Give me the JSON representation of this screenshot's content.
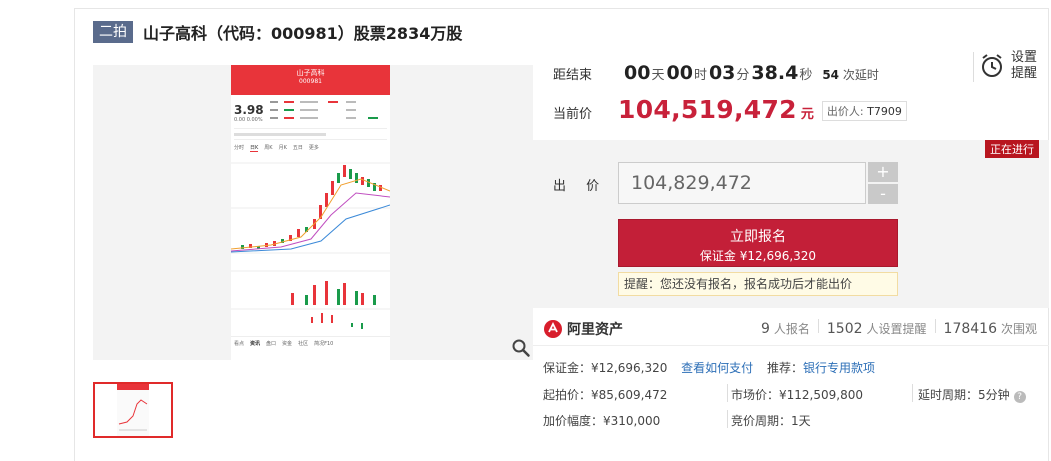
{
  "title": {
    "badge": "二拍",
    "text": "山子高科（代码：000981）股票2834万股"
  },
  "countdown": {
    "label": "距结束",
    "days": "00",
    "days_unit": "天",
    "hours": "00",
    "hours_unit": "时",
    "minutes": "03",
    "minutes_unit": "分",
    "seconds": "38.4",
    "seconds_unit": "秒",
    "delay_count": "54",
    "delay_label": "次延时"
  },
  "remind": {
    "line1": "设置",
    "line2": "提醒"
  },
  "current_price": {
    "label": "当前价",
    "value": "104,519,472",
    "unit": "元",
    "bidder_label": "出价人:",
    "bidder_id": "T7909"
  },
  "status": "正在进行",
  "bid": {
    "label": "出 价",
    "value": "104,829,472",
    "plus": "+",
    "minus": "-",
    "signup_label": "立即报名",
    "deposit_label": "保证金 ¥12,696,320",
    "tip": "提醒：您还没有报名，报名成功后才能出价"
  },
  "platform": {
    "name": "阿里资产"
  },
  "stats": {
    "signup_count": "9",
    "signup_label": "人报名",
    "remind_count": "1502",
    "remind_label": "人设置提醒",
    "watch_count": "178416",
    "watch_label": "次围观"
  },
  "details": {
    "deposit": "保证金：¥12,696,320",
    "how_to_pay": "查看如何支付",
    "recommend_label": "推荐：",
    "recommend_link": "银行专用款项",
    "start_price": "起拍价：¥85,609,472",
    "market_price": "市场价：¥112,509,800",
    "delay_period": "延时周期：5分钟",
    "increment": "加价幅度：¥310,000",
    "bid_period": "竞价周期：1天"
  },
  "phone_shot": {
    "stock_name": "山子高科",
    "stock_code": "000981",
    "price": "3.98",
    "change": "0.00 0.00%",
    "tabs": [
      "分时",
      "日K",
      "周K",
      "月K",
      "五日",
      "更多"
    ],
    "bottom_tabs": [
      "看点",
      "资讯",
      "盘口",
      "资金",
      "社区",
      "简况F10"
    ]
  }
}
